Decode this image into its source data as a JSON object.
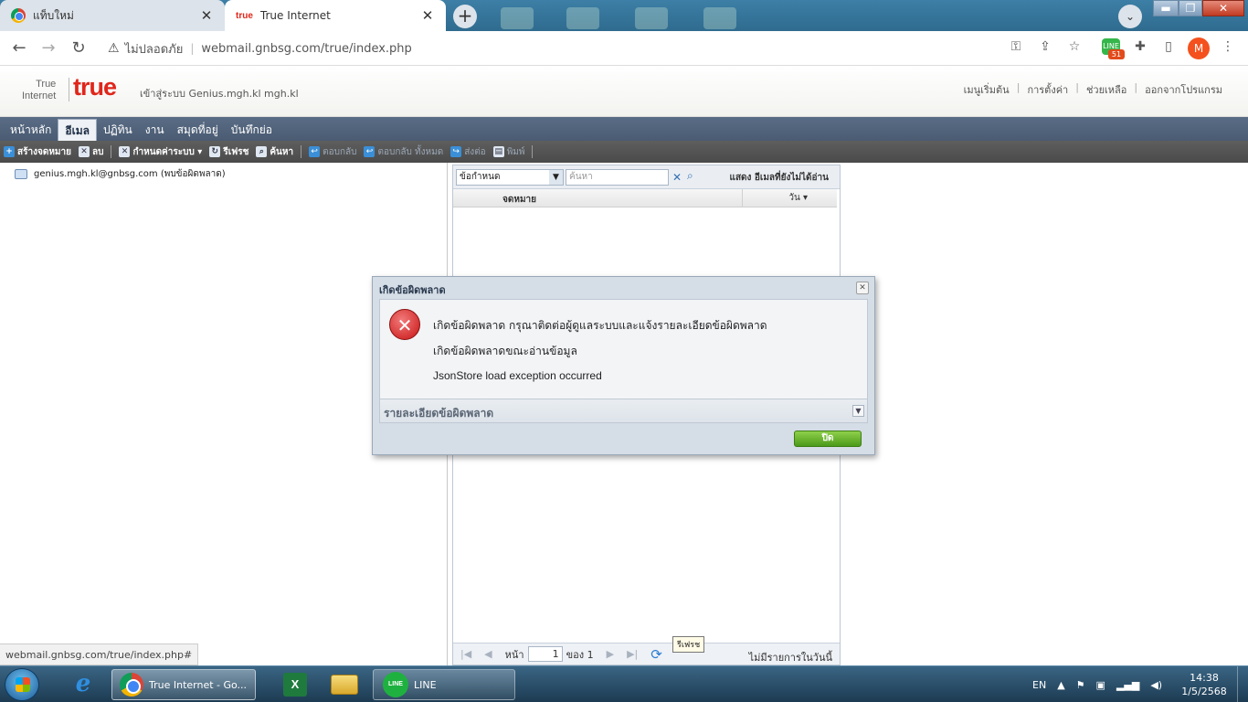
{
  "browser": {
    "tabs": [
      {
        "title": "แท็บใหม่",
        "close": "✕"
      },
      {
        "title": "True Internet",
        "favicon": "true",
        "close": "✕"
      }
    ],
    "new_tab": "+",
    "tab_search": "⌄",
    "window_controls": {
      "minimize": "▬",
      "maximize": "❐",
      "close": "✕"
    },
    "nav": {
      "back": "←",
      "forward": "→",
      "reload": "↻"
    },
    "security_icon": "⚠",
    "security_label": "ไม่ปลอดภัย",
    "url": "webmail.gnbsg.com/true/index.php",
    "toolbar_icons": {
      "key": "⚿",
      "share": "⇪",
      "star": "☆",
      "puzzle": "✚",
      "sidepanel": "▯",
      "menu": "⋮"
    },
    "extension_badge": "51",
    "profile_initial": "M"
  },
  "webmail": {
    "logo_line1": "True",
    "logo_line2": "Internet",
    "logo_word": "true",
    "login_text": "เข้าสู่ระบบ Genius.mgh.kl mgh.kl",
    "top_links": [
      "เมนูเริ่มต้น",
      "การตั้งค่า",
      "ช่วยเหลือ",
      "ออกจากโปรแกรม"
    ],
    "top_link_sep": "|",
    "nav_tabs": [
      "หน้าหลัก",
      "อีเมล",
      "ปฏิทิน",
      "งาน",
      "สมุดที่อยู่",
      "บันทึกย่อ"
    ],
    "toolbar": {
      "compose": "สร้างจดหมาย",
      "delete": "ลบ",
      "system_config": "กำหนดค่าระบบ",
      "refresh": "รีเฟรช",
      "search": "ค้นหา",
      "reply": "ตอบกลับ",
      "reply_all": "ตอบกลับ ทั้งหมด",
      "forward": "ส่งต่อ",
      "print": "พิมพ์"
    },
    "folder_tree": {
      "account": "genius.mgh.kl@gnbsg.com (พบข้อผิดพลาด)"
    },
    "status_url": "webmail.gnbsg.com/true/index.php#",
    "list": {
      "filter_label": "ข้อกำหนด",
      "search_placeholder": "ค้นหา",
      "unread_toggle": "แสดง อีเมลที่ยังไม่ได้อ่าน",
      "col_subject": "จดหมาย",
      "col_date": "วัน",
      "page_label": "หน้า",
      "page_value": "1",
      "page_of": "ของ 1",
      "refresh_tooltip": "รีเฟรช",
      "no_items": "ไม่มีรายการในวันนี้"
    }
  },
  "dialog": {
    "title": "เกิดข้อผิดพลาด",
    "close_glyph": "✕",
    "message": "เกิดข้อผิดพลาด กรุณาติดต่อผู้ดูแลระบบและแจ้งรายละเอียดข้อผิดพลาด",
    "detail": "เกิดข้อผิดพลาดขณะอ่านข้อมูล",
    "exception": "JsonStore load exception occurred",
    "details_label": "รายละเอียดข้อผิดพลาด",
    "close_button": "ปิด"
  },
  "taskbar": {
    "chrome_label": "True Internet - Go...",
    "line_label": "LINE",
    "language": "EN",
    "time": "14:38",
    "date": "1/5/2568"
  }
}
